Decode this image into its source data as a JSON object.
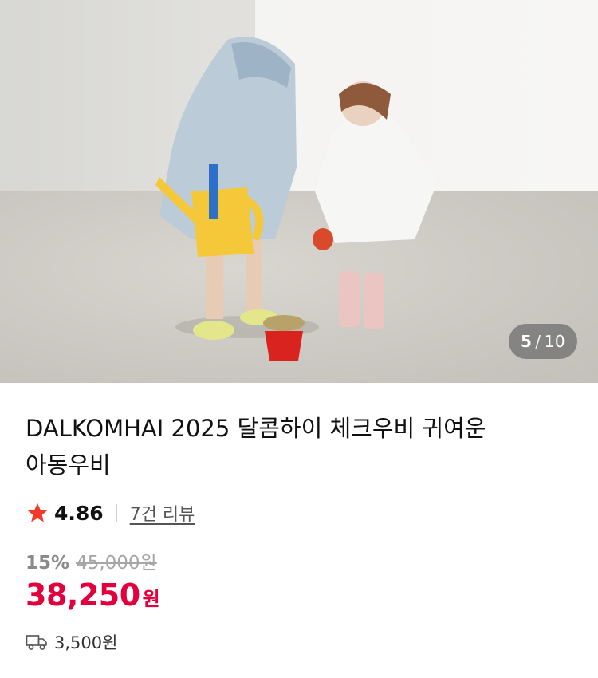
{
  "gallery": {
    "current": "5",
    "separator": "/",
    "total": "10"
  },
  "product": {
    "title_line1": "DALKOMHAI 2025 달콤하이 체크우비 귀여운",
    "title_line2": "아동우비",
    "rating": "4.86",
    "review_count_label": "7건 리뷰",
    "discount": "15%",
    "original_price": "45,000원",
    "sale_price": "38,250",
    "currency": "원",
    "shipping_fee": "3,500원"
  },
  "colors": {
    "accent_red": "#e1003b",
    "star": "#f33a2a"
  },
  "icons": {
    "rating": "star-icon",
    "shipping": "truck-icon"
  }
}
